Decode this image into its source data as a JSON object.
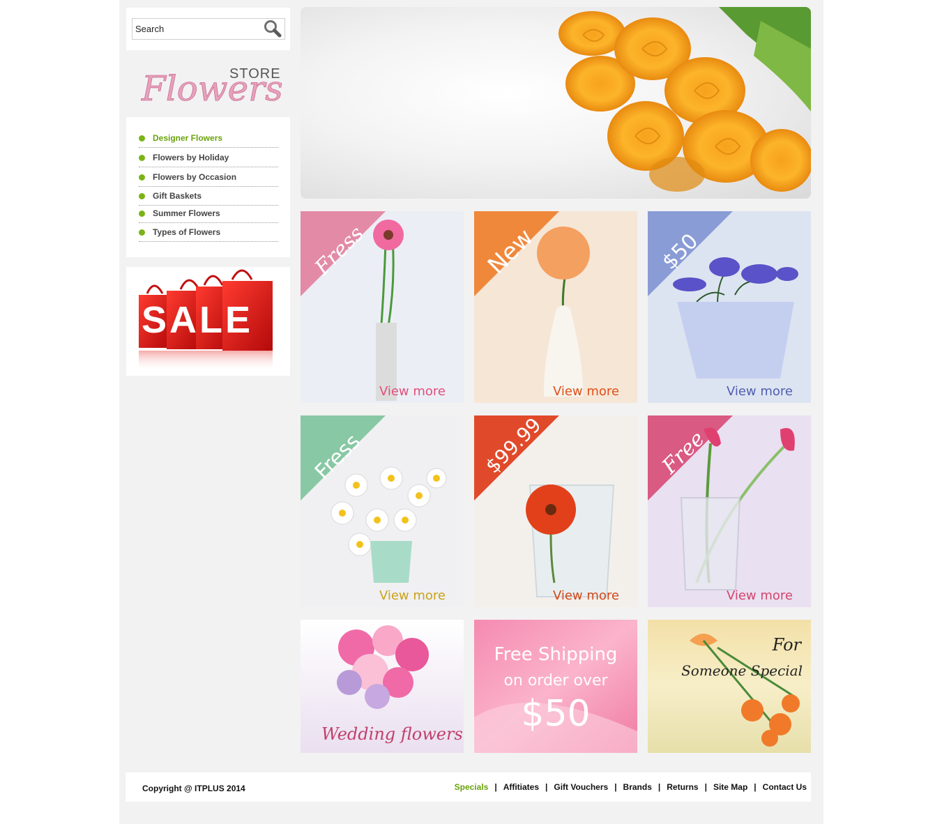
{
  "search": {
    "placeholder": "Search"
  },
  "logo": {
    "script_text": "Flowers",
    "store_text": "STORE"
  },
  "menu": {
    "items": [
      {
        "label": "Designer Flowers",
        "active": true
      },
      {
        "label": "Flowers by Holiday",
        "active": false
      },
      {
        "label": "Flowers by Occasion",
        "active": false
      },
      {
        "label": "Gift Baskets",
        "active": false
      },
      {
        "label": "Summer Flowers",
        "active": false
      },
      {
        "label": "Types of Flowers",
        "active": false
      }
    ]
  },
  "sale_banner": {
    "text": "SALE"
  },
  "products": [
    {
      "ribbon": "Fress",
      "ribbon_color": "#e38aa6",
      "cta": "View more",
      "cta_color": "#e0507a",
      "bg": "#eceef6"
    },
    {
      "ribbon": "New",
      "ribbon_color": "#f0883c",
      "cta": "View more",
      "cta_color": "#e0501a",
      "bg": "#f6e6d6"
    },
    {
      "ribbon": "$50",
      "ribbon_color": "#8a9cd6",
      "cta": "View more",
      "cta_color": "#4f5fb0",
      "bg": "#dde4f1"
    },
    {
      "ribbon": "Fress",
      "ribbon_color": "#88c8a4",
      "cta": "View more",
      "cta_color": "#c9a21a",
      "bg": "#f0f0f2"
    },
    {
      "ribbon": "$99.99",
      "ribbon_color": "#e04a2a",
      "cta": "View more",
      "cta_color": "#d04818",
      "bg": "#f3f0ec"
    },
    {
      "ribbon": "Free",
      "ribbon_color": "#d95a83",
      "cta": "View more",
      "cta_color": "#d1466c",
      "bg": "#e9e0f1"
    }
  ],
  "promos": {
    "wedding": "Wedding flowers",
    "shipping_line1": "Free Shipping",
    "shipping_line2": "on order over",
    "shipping_amount": "$50",
    "special_line1": "For",
    "special_line2": "Someone Special"
  },
  "footer": {
    "copyright": "Copyright @ ITPLUS 2014",
    "links": [
      "Specials",
      "Affitiates",
      "Gift Vouchers",
      "Brands",
      "Returns",
      "Site Map",
      "Contact Us"
    ],
    "active_link": "Specials"
  },
  "colors": {
    "accent_green": "#6aa20d",
    "page_bg": "#f2f2f2"
  }
}
